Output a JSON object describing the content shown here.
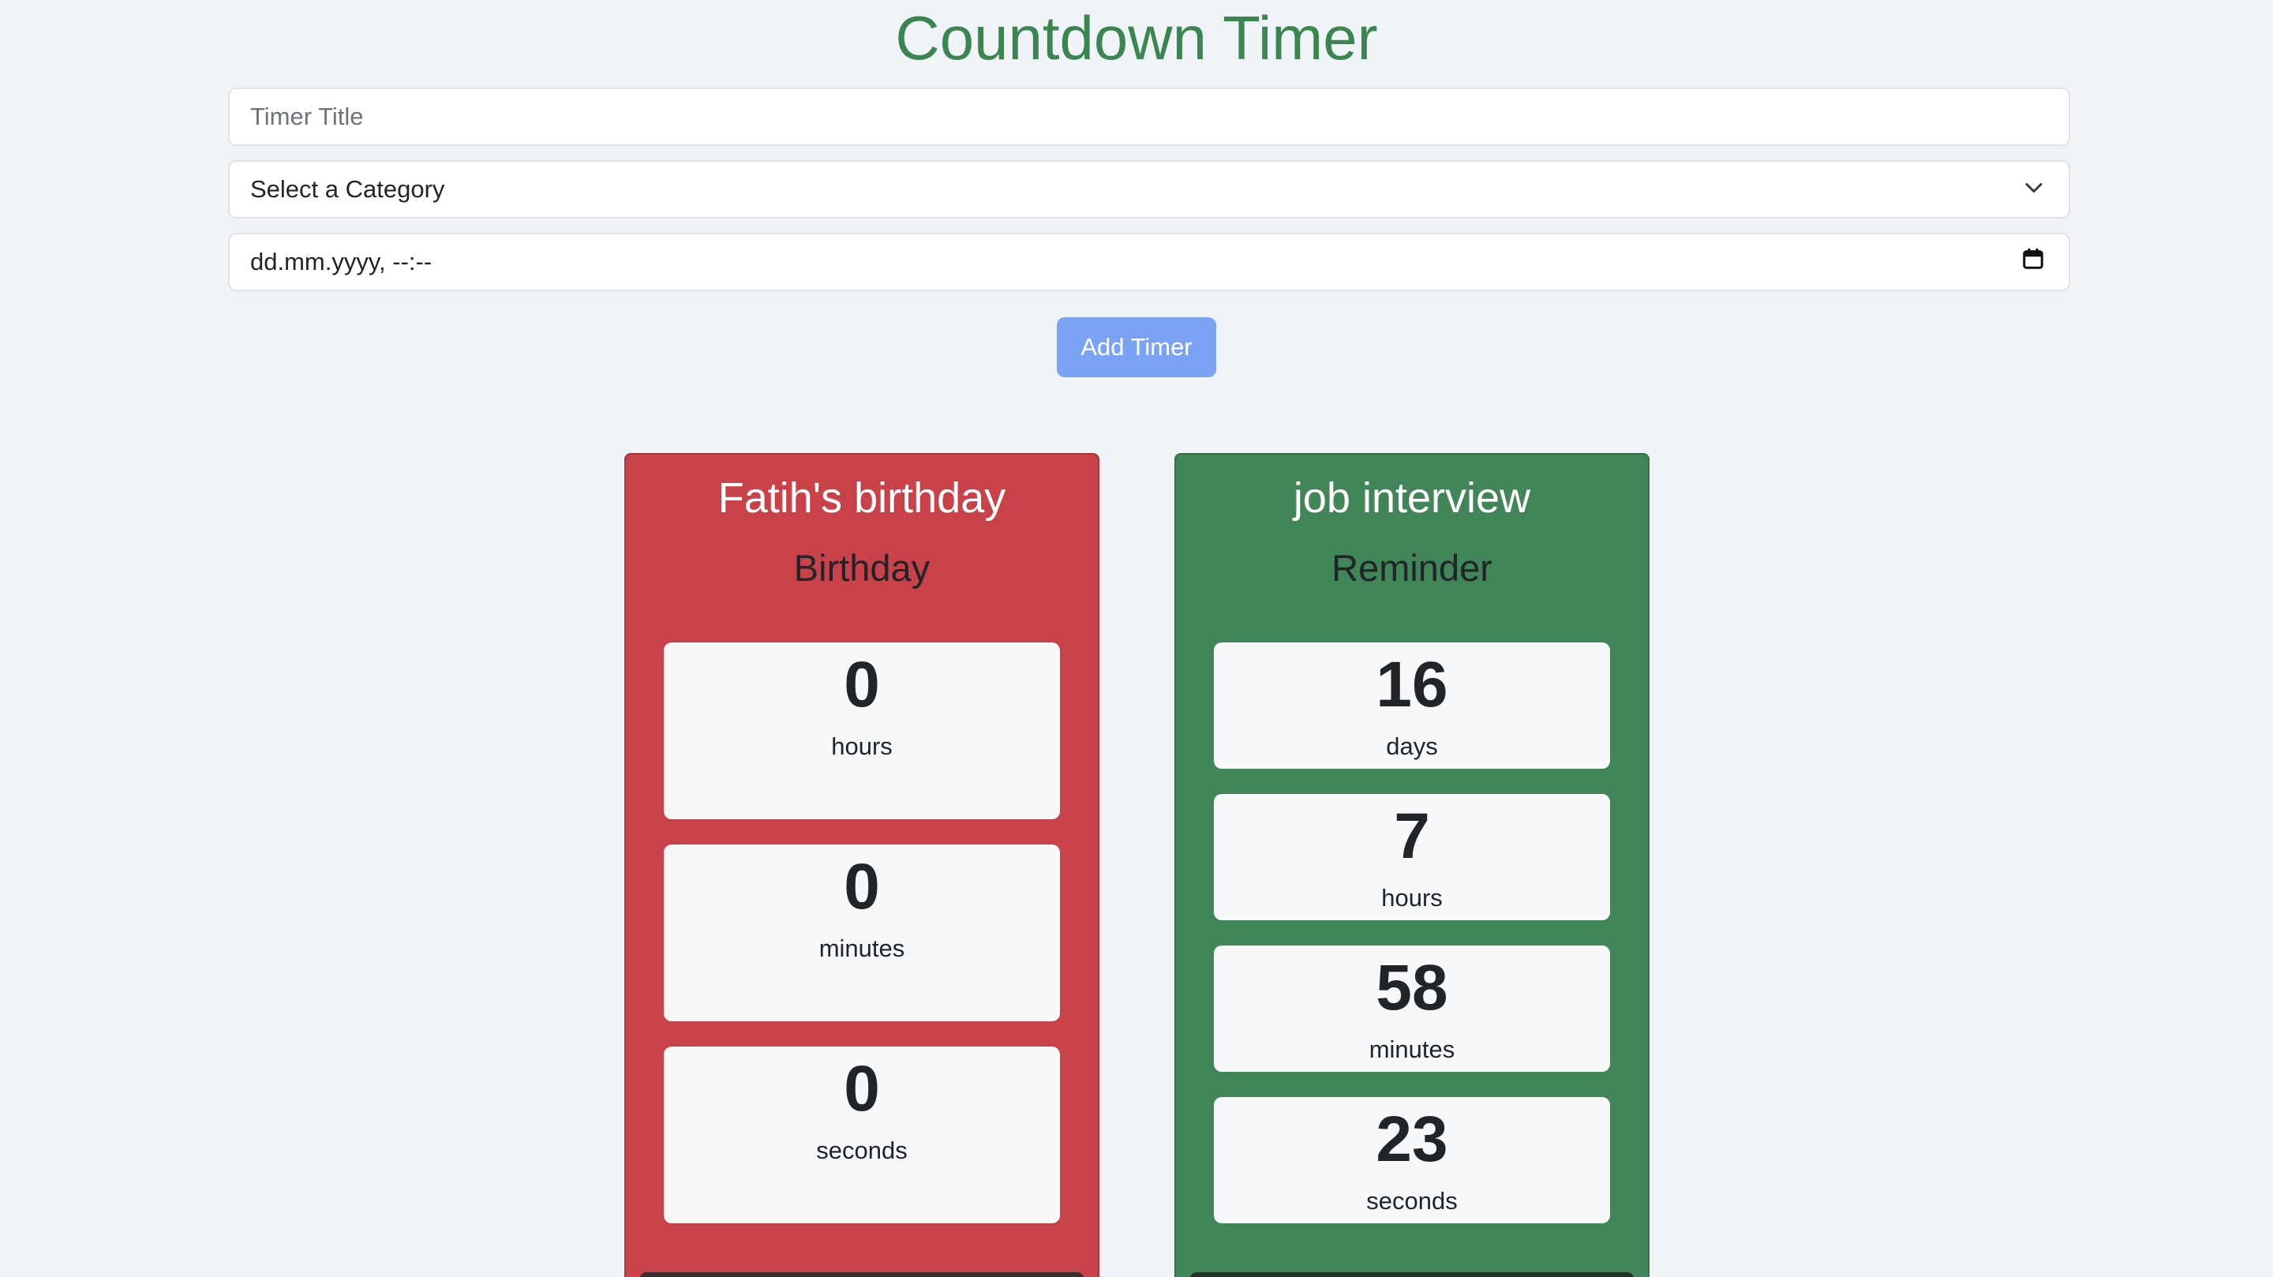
{
  "page": {
    "title": "Countdown Timer"
  },
  "form": {
    "title_placeholder": "Timer Title",
    "category_selected": "Select a Category",
    "datetime_placeholder": "dd.mm.yyyy, --:--",
    "add_button_label": "Add Timer"
  },
  "timers": [
    {
      "title": "Fatih's birthday",
      "category": "Birthday",
      "color": "#c9424a",
      "units": [
        {
          "value": "0",
          "label": "hours"
        },
        {
          "value": "0",
          "label": "minutes"
        },
        {
          "value": "0",
          "label": "seconds"
        }
      ]
    },
    {
      "title": "job interview",
      "category": "Reminder",
      "color": "#428558",
      "units": [
        {
          "value": "16",
          "label": "days"
        },
        {
          "value": "7",
          "label": "hours"
        },
        {
          "value": "58",
          "label": "minutes"
        },
        {
          "value": "23",
          "label": "seconds"
        }
      ]
    }
  ],
  "colors": {
    "heading": "#3b8551",
    "button": "#7ba3f4",
    "background": "#f0f3f8"
  },
  "icons": {
    "select": "chevron-down-icon",
    "datetime": "calendar-icon"
  }
}
